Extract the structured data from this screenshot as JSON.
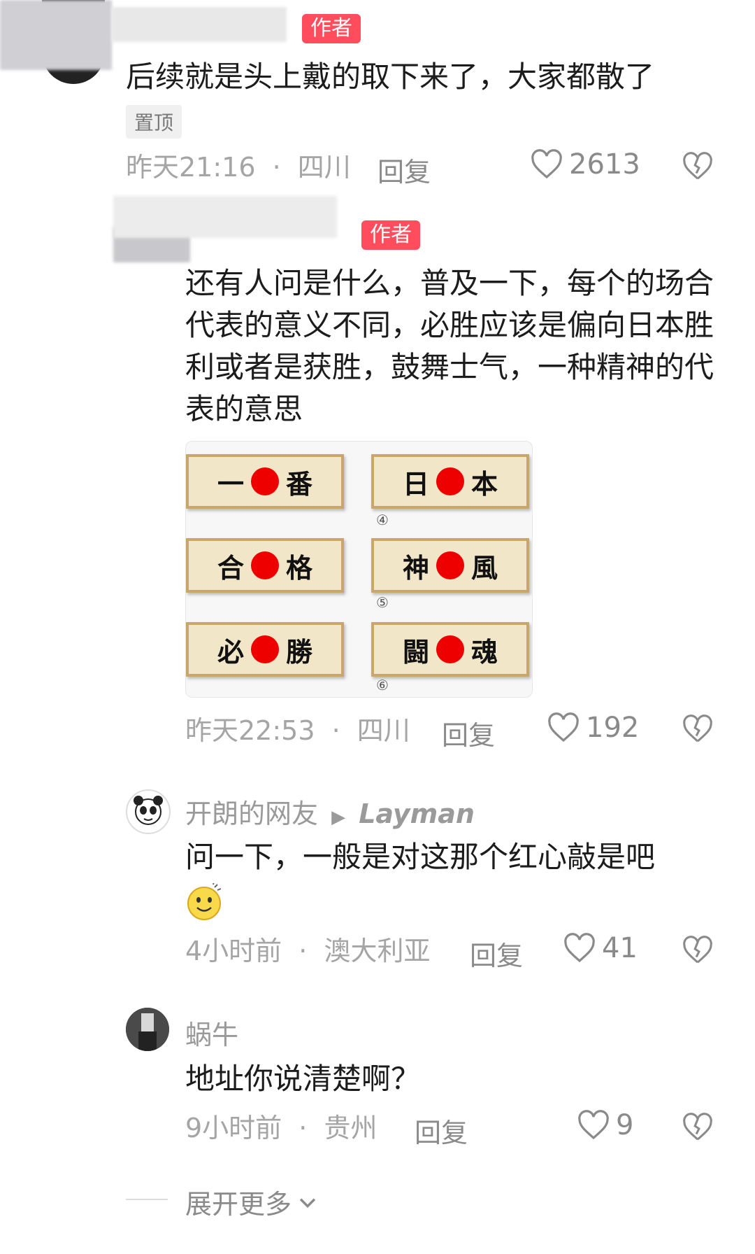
{
  "comments": [
    {
      "tag": "作者",
      "text": "后续就是头上戴的取下来了，大家都散了",
      "pinned_label": "置顶",
      "time": "昨天21:16",
      "location": "四川",
      "reply_label": "回复",
      "likes": "2613"
    },
    {
      "tag": "作者",
      "text": "还有人问是什么，普及一下，每个的场合代表的意义不同，必胜应该是偏向日本胜利或者是获胜，鼓舞士气，一种精神的代表的意思",
      "image_cells": [
        {
          "a": "一",
          "b": "番",
          "num": ""
        },
        {
          "a": "日",
          "b": "本",
          "num": "④"
        },
        {
          "a": "合",
          "b": "格",
          "num": ""
        },
        {
          "a": "神",
          "b": "風",
          "num": "⑤"
        },
        {
          "a": "必",
          "b": "勝",
          "num": ""
        },
        {
          "a": "闘",
          "b": "魂",
          "num": "⑥"
        }
      ],
      "time": "昨天22:53",
      "location": "四川",
      "reply_label": "回复",
      "likes": "192"
    },
    {
      "username": "开朗的网友",
      "reply_to": "Layman",
      "text": "问一下，一般是对这那个红心敲是吧",
      "time": "4小时前",
      "location": "澳大利亚",
      "reply_label": "回复",
      "likes": "41"
    },
    {
      "username": "蜗牛",
      "text": "地址你说清楚啊？",
      "time": "9小时前",
      "location": "贵州",
      "reply_label": "回复",
      "likes": "9"
    }
  ],
  "expand_more": "展开更多",
  "meta_separator": "·",
  "colors": {
    "author_tag": "#ff4d5e",
    "meta": "#a5a5a5"
  },
  "icons": [
    "heart-icon",
    "broken-heart-icon",
    "chevron-down-icon"
  ]
}
